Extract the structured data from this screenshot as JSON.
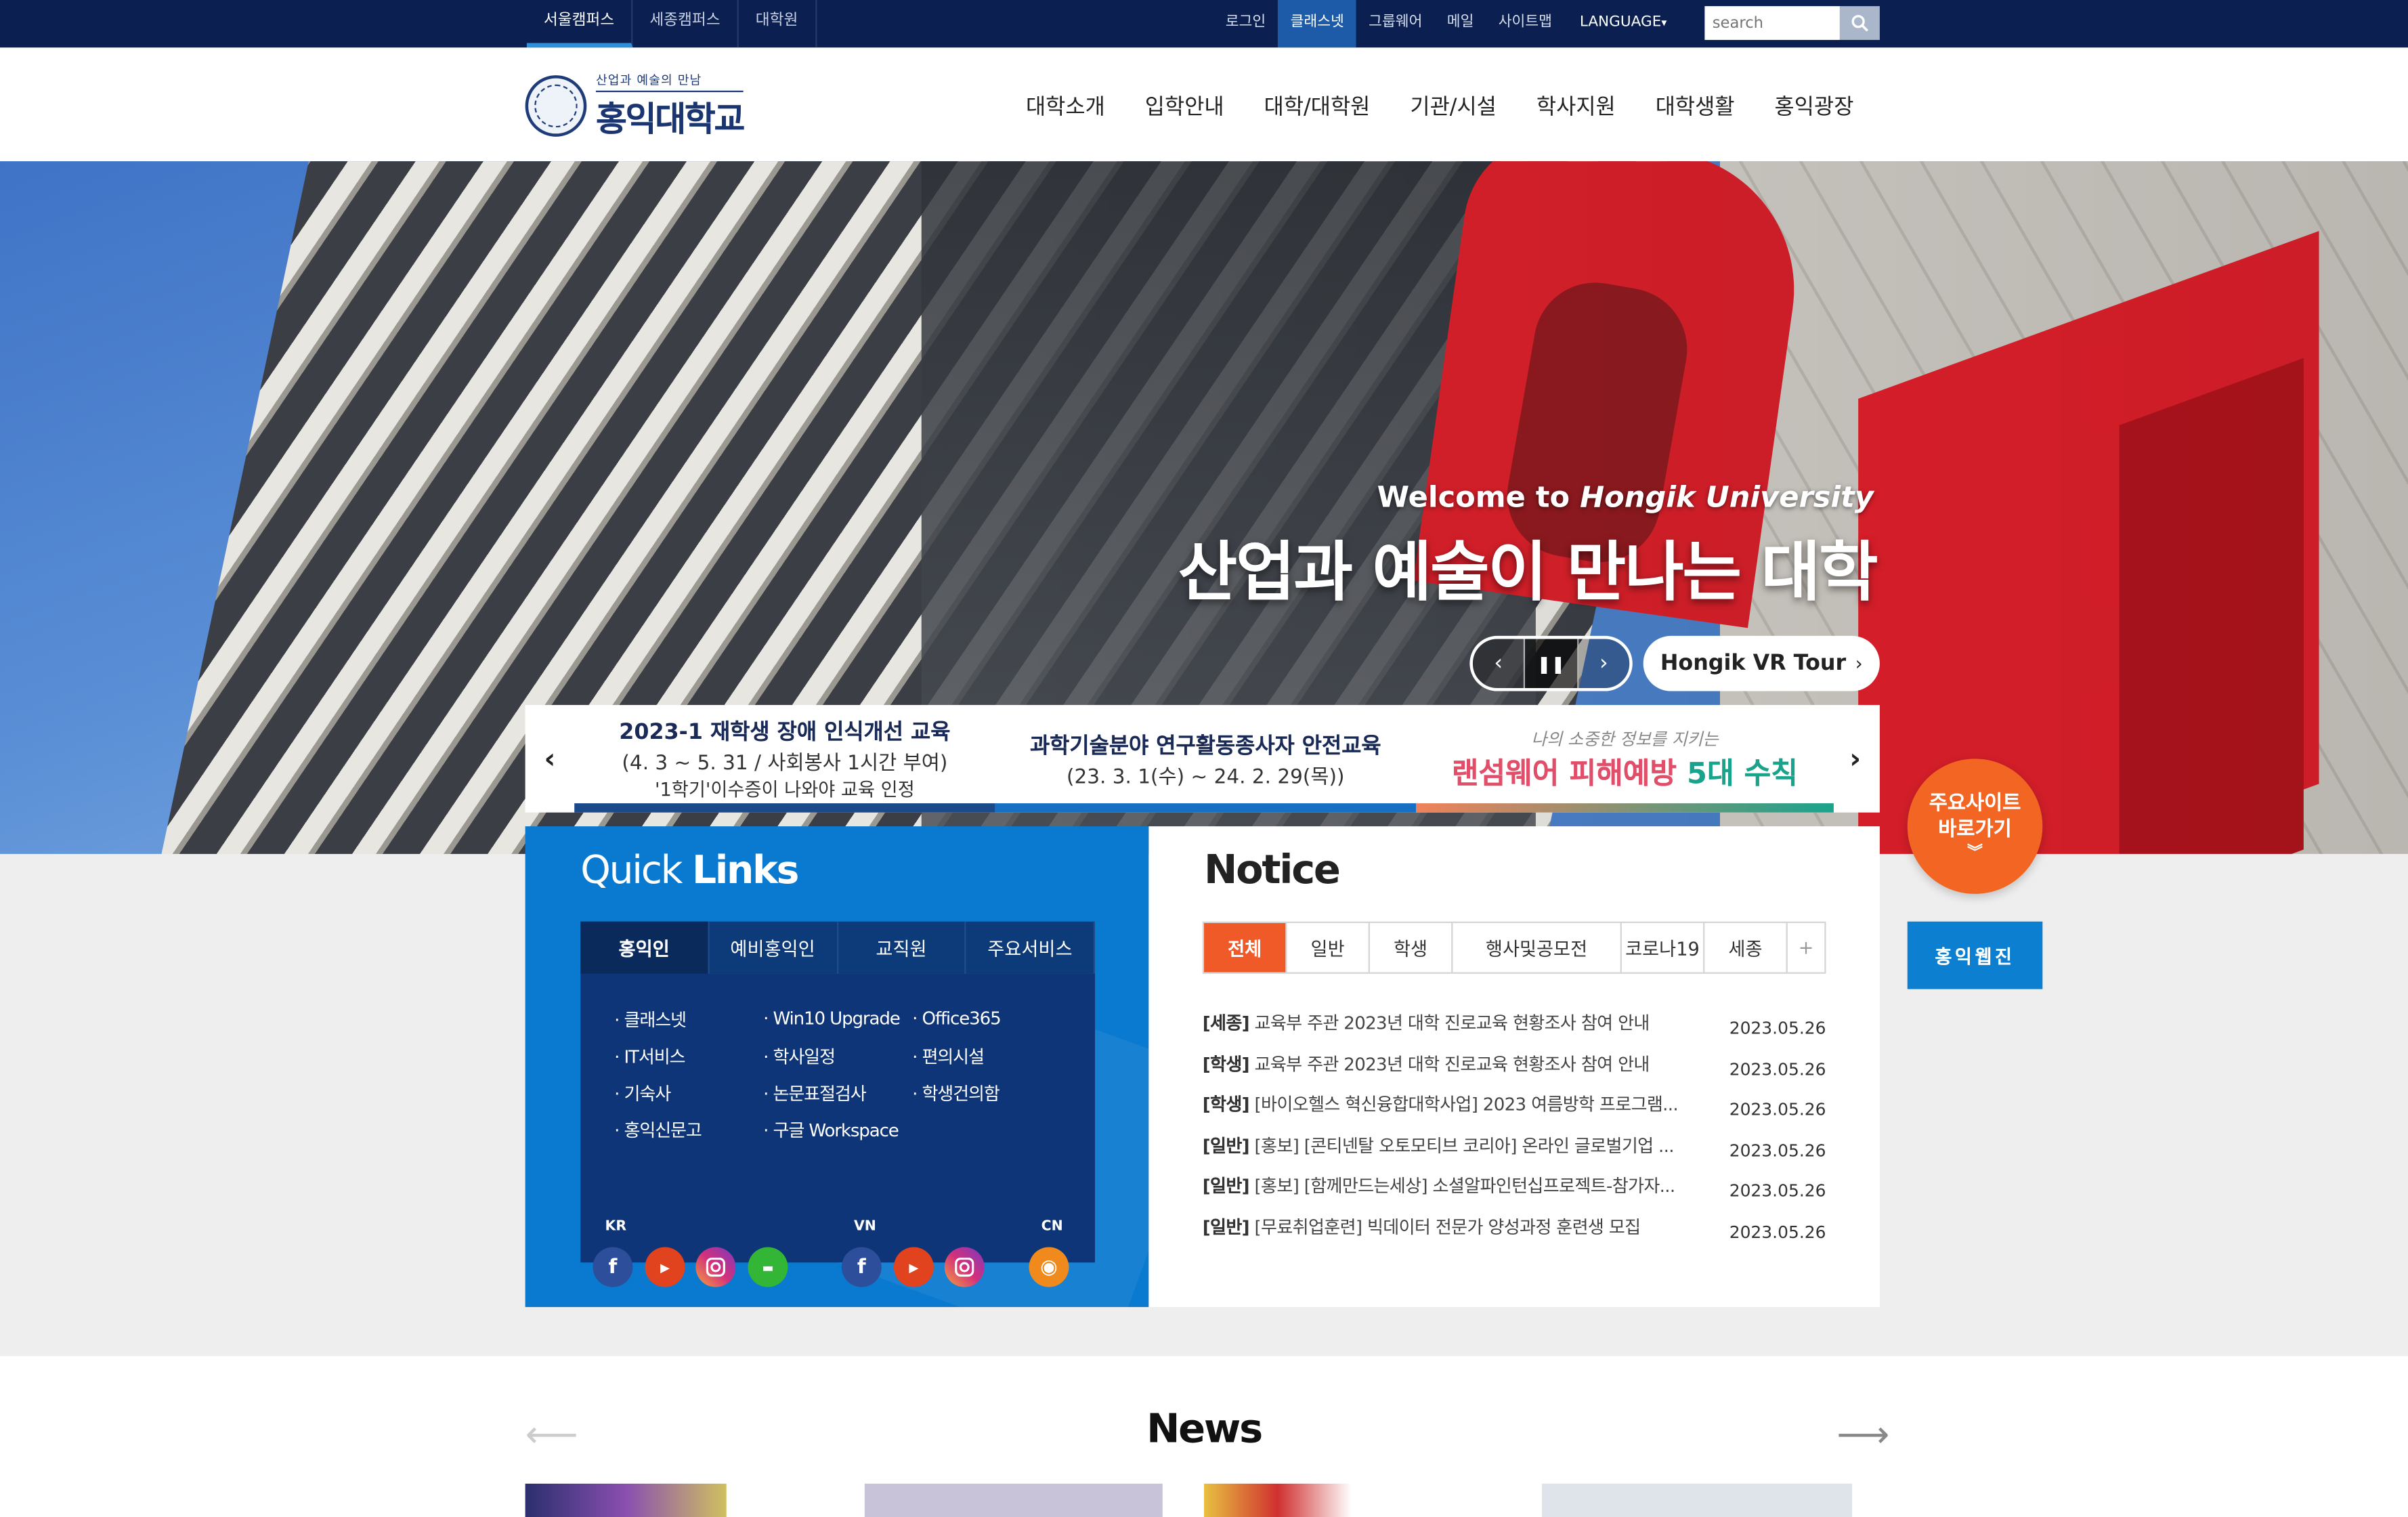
{
  "topbar": {
    "campus_tabs": [
      "서울캠퍼스",
      "세종캠퍼스",
      "대학원"
    ],
    "links": [
      "로그인",
      "클래스넷",
      "그룹웨어",
      "메일",
      "사이트맵"
    ],
    "language": "LANGUAGE",
    "search_placeholder": "search"
  },
  "header": {
    "logo_sub": "산업과 예술의 만남",
    "logo_main": "홍익대학교",
    "nav": [
      "대학소개",
      "입학안내",
      "대학/대학원",
      "기관/시설",
      "학사지원",
      "대학생활",
      "홍익광장"
    ]
  },
  "hero": {
    "welcome_prefix": "Welcome to ",
    "welcome_name": "Hongik University",
    "title": "산업과 예술이 만나는 대학",
    "vr_button": "Hongik VR Tour"
  },
  "banners": [
    {
      "l1": "2023-1 재학생 장애 인식개선 교육",
      "l2": "(4. 3 ~ 5. 31 / 사회봉사 1시간 부여)",
      "l3": "'1학기'이수증이 나와야 교육 인정"
    },
    {
      "l1": "과학기술분야 연구활동종사자 안전교육",
      "l2": "(23. 3. 1(수) ~ 24. 2. 29(목))"
    },
    {
      "top": "나의 소중한 정보를 지키는",
      "main_a": "랜섬웨어 피해예방 ",
      "main_b": "5대 수칙"
    }
  ],
  "quick_links": {
    "title_a": "Quick ",
    "title_b": "Links",
    "tabs": [
      "홍익인",
      "예비홍익인",
      "교직원",
      "주요서비스"
    ],
    "col1": [
      "· 클래스넷",
      "· IT서비스",
      "· 기숙사",
      "· 홍익신문고"
    ],
    "col2": [
      "· Win10 Upgrade",
      "· 학사일정",
      "· 논문표절검사",
      "· 구글 Workspace"
    ],
    "col3": [
      "· Office365",
      "· 편의시설",
      "· 학생건의함"
    ],
    "social_labels": [
      "KR",
      "VN",
      "CN"
    ]
  },
  "notice": {
    "title": "Notice",
    "tabs": [
      "전체",
      "일반",
      "학생",
      "행사및공모전",
      "코로나19",
      "세종",
      "+"
    ],
    "items": [
      {
        "cat": "[세종]",
        "text": " 교육부 주관 2023년 대학 진로교육 현황조사 참여 안내",
        "date": "2023.05.26"
      },
      {
        "cat": "[학생]",
        "text": "  교육부 주관 2023년 대학 진로교육 현황조사 참여 안내",
        "date": "2023.05.26"
      },
      {
        "cat": "[학생]",
        "text": " [바이오헬스 혁신융합대학사업] 2023 여름방학 프로그램...",
        "date": "2023.05.26"
      },
      {
        "cat": "[일반]",
        "text": " [홍보] [콘티넨탈 오토모티브 코리아] 온라인 글로벌기업 ...",
        "date": "2023.05.26"
      },
      {
        "cat": "[일반]",
        "text": " [홍보] [함께만드는세상] 소셜알파인턴십프로젝트-참가자...",
        "date": "2023.05.26"
      },
      {
        "cat": "[일반]",
        "text": " [무료취업훈련] 빅데이터 전문가 양성과정 훈련생 모집",
        "date": "2023.05.26"
      }
    ]
  },
  "side": {
    "main_sites_l1": "주요사이트",
    "main_sites_l2": "바로가기",
    "webzine": "홍익웹진"
  },
  "news": {
    "title": "News"
  },
  "colors": {
    "navy": "#0b2050",
    "accent_orange": "#f05a28",
    "quick_blue": "#0a7ad0"
  }
}
